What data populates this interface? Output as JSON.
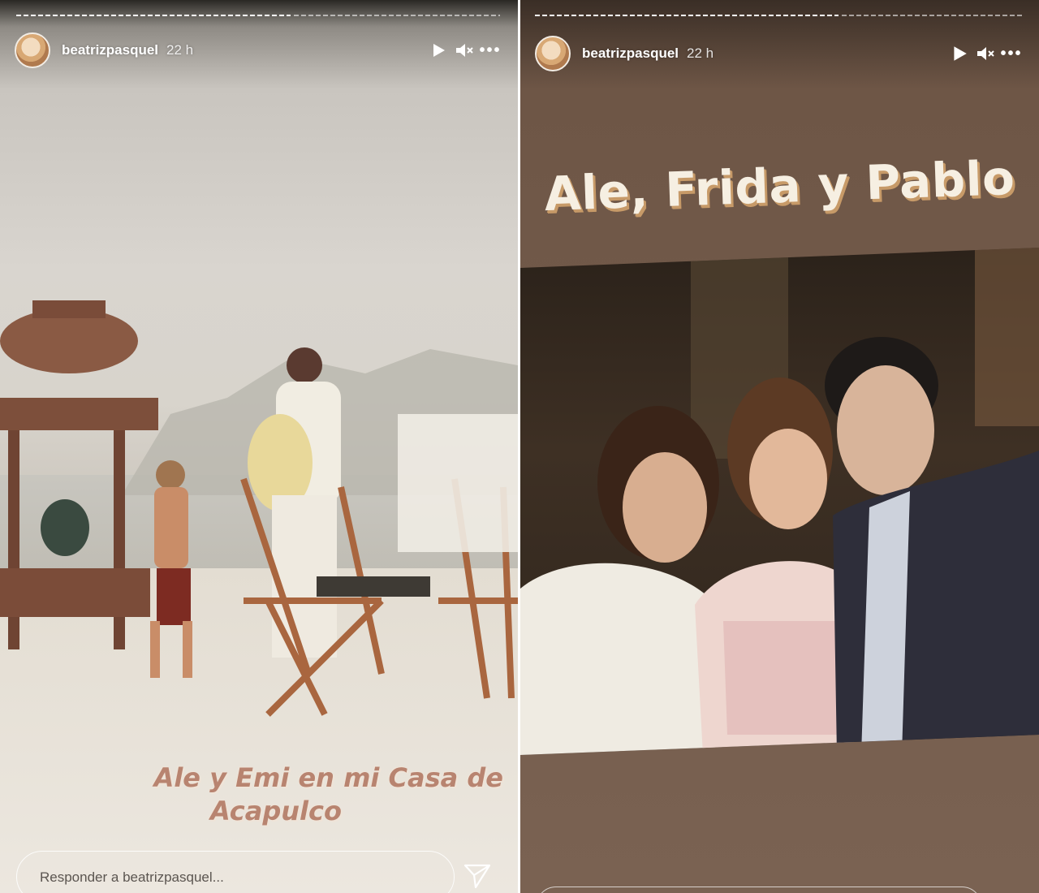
{
  "stories": [
    {
      "username": "beatrizpasquel",
      "time": "22 h",
      "caption_line1": "Ale y Emi en mi Casa de",
      "caption_line2": "Acapulco",
      "reply_placeholder": "Responder a beatrizpasquel...",
      "progress": [
        1.0,
        0.0
      ]
    },
    {
      "username": "beatrizpasquel",
      "time": "22 h",
      "headline": "Ale, Frida y Pablo",
      "progress": [
        1.0,
        0.0
      ]
    }
  ],
  "icons": {
    "play": "play-icon",
    "mute": "muted-speaker-icon",
    "more": "more-options-icon",
    "send": "send-icon"
  },
  "colors": {
    "caption": "#b88470",
    "headline": "#f6efe2",
    "headline_shadow": "#c79a68"
  }
}
